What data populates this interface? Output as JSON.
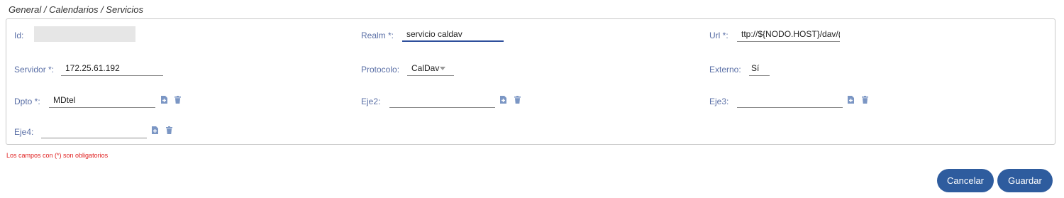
{
  "breadcrumb": "General / Calendarios / Servicios",
  "form": {
    "id": {
      "label": "Id:",
      "value": ""
    },
    "realm": {
      "label": "Realm *:",
      "value": "servicio caldav"
    },
    "url": {
      "label": "Url *:",
      "value": "ttp://${NODO.HOST}/dav/("
    },
    "servidor": {
      "label": "Servidor *:",
      "value": "172.25.61.192"
    },
    "protocolo": {
      "label": "Protocolo:",
      "value": "CalDav"
    },
    "externo": {
      "label": "Externo:",
      "value": "Sí"
    },
    "dpto": {
      "label": "Dpto *:",
      "value": "MDtel"
    },
    "eje2": {
      "label": "Eje2:",
      "value": ""
    },
    "eje3": {
      "label": "Eje3:",
      "value": ""
    },
    "eje4": {
      "label": "Eje4:",
      "value": ""
    }
  },
  "required_note": "Los campos con (*) son obligatorios",
  "buttons": {
    "cancel": "Cancelar",
    "save": "Guardar"
  },
  "colors": {
    "label": "#5a6fa6",
    "accent": "#2e5c9e",
    "icon": "#7b96c4",
    "error": "#e02020"
  },
  "icons": {
    "add": "add-file-icon",
    "delete": "trash-icon",
    "dropdown": "chevron-down-icon"
  }
}
